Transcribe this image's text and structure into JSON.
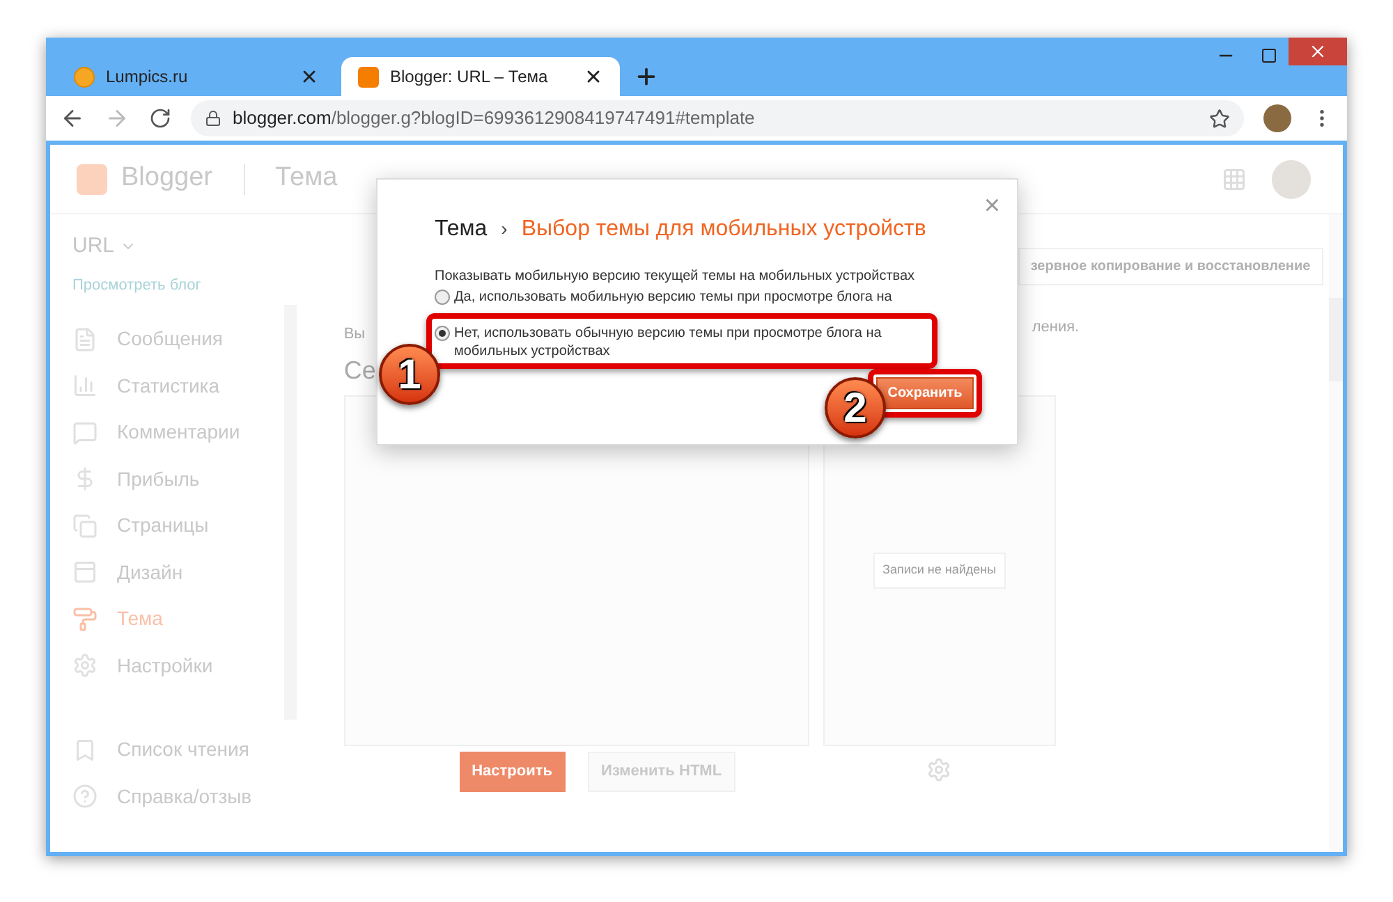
{
  "browser": {
    "tabs": [
      {
        "title": "Lumpics.ru",
        "selected": false
      },
      {
        "title": "Blogger: URL – Тема",
        "selected": true
      }
    ],
    "address": {
      "host": "blogger.com",
      "path": "/blogger.g?blogID=6993612908419747491#template"
    }
  },
  "header": {
    "logo": "Blogger",
    "section": "Тема"
  },
  "sidebar": {
    "blog_name": "URL",
    "view_blog": "Просмотреть блог",
    "items": [
      {
        "label": "Сообщения",
        "selected": false
      },
      {
        "label": "Статистика",
        "selected": false
      },
      {
        "label": "Комментарии",
        "selected": false
      },
      {
        "label": "Прибыль",
        "selected": false
      },
      {
        "label": "Страницы",
        "selected": false
      },
      {
        "label": "Дизайн",
        "selected": false
      },
      {
        "label": "Тема",
        "selected": true
      },
      {
        "label": "Настройки",
        "selected": false
      }
    ],
    "extra_items": [
      {
        "label": "Список чтения"
      },
      {
        "label": "Справка/отзыв"
      }
    ]
  },
  "main": {
    "backup_button": "зервное копирование и восстановление",
    "intro_start": "Вы",
    "intro_end": "ления.",
    "heading_start": "Се",
    "customize_button": "Настроить",
    "edit_html_button": "Изменить HTML",
    "mobile_empty": "Записи не найдены"
  },
  "dialog": {
    "parent": "Тема",
    "separator": "›",
    "title": "Выбор темы для мобильных устройств",
    "question": "Показывать мобильную версию текущей темы на мобильных устройствах",
    "options": [
      {
        "label": "Да, использовать мобильную версию темы при просмотре блога на",
        "selected": false
      },
      {
        "label": "Нет, использовать обычную версию темы при просмотре блога на мобильных устройствах",
        "selected": true
      }
    ],
    "save": "Сохранить",
    "close": "×"
  },
  "markers": [
    {
      "number": "1"
    },
    {
      "number": "2"
    }
  ]
}
